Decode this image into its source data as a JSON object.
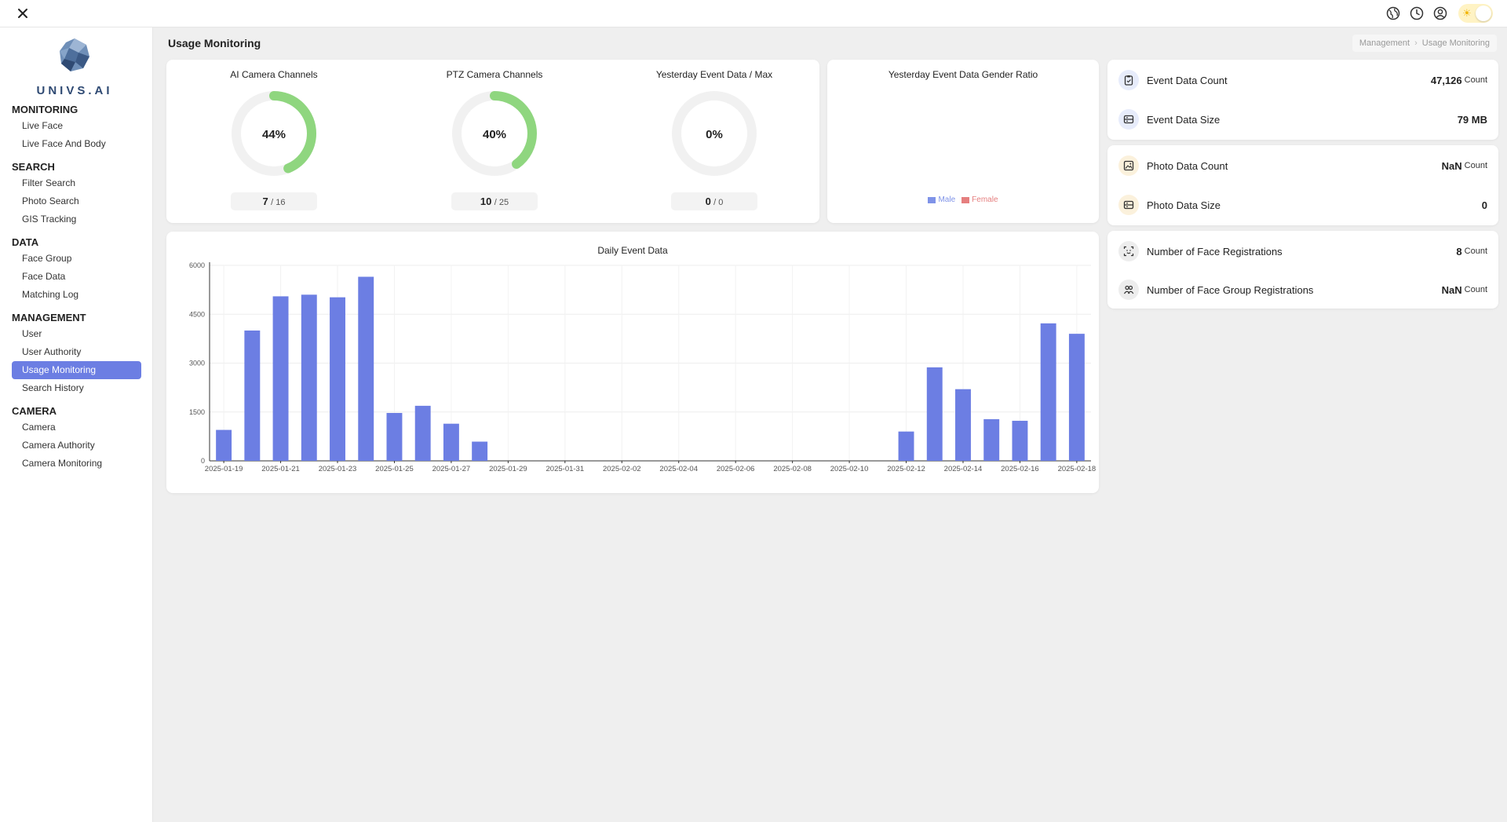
{
  "topbar": {
    "icons": [
      "globe-icon",
      "clock-icon",
      "user-icon",
      "sun-icon"
    ]
  },
  "logo": {
    "text": "UNIVS.AI"
  },
  "sidebar": {
    "sections": [
      {
        "title": "MONITORING",
        "items": [
          {
            "label": "Live Face"
          },
          {
            "label": "Live Face And Body"
          }
        ]
      },
      {
        "title": "SEARCH",
        "items": [
          {
            "label": "Filter Search"
          },
          {
            "label": "Photo Search"
          },
          {
            "label": "GIS Tracking"
          }
        ]
      },
      {
        "title": "DATA",
        "items": [
          {
            "label": "Face Group"
          },
          {
            "label": "Face Data"
          },
          {
            "label": "Matching Log"
          }
        ]
      },
      {
        "title": "MANAGEMENT",
        "items": [
          {
            "label": "User"
          },
          {
            "label": "User Authority"
          },
          {
            "label": "Usage Monitoring",
            "active": true
          },
          {
            "label": "Search History"
          }
        ]
      },
      {
        "title": "CAMERA",
        "items": [
          {
            "label": "Camera"
          },
          {
            "label": "Camera Authority"
          },
          {
            "label": "Camera Monitoring"
          }
        ]
      }
    ]
  },
  "page": {
    "title": "Usage Monitoring",
    "breadcrumb": [
      "Management",
      "Usage Monitoring"
    ]
  },
  "gauges": [
    {
      "title": "AI Camera Channels",
      "percent_label": "44%",
      "fraction": 0.4375,
      "num": "7",
      "den": "/ 16"
    },
    {
      "title": "PTZ Camera Channels",
      "percent_label": "40%",
      "fraction": 0.4,
      "num": "10",
      "den": "/ 25"
    },
    {
      "title": "Yesterday Event Data / Max",
      "percent_label": "0%",
      "fraction": 0.0,
      "num": "0",
      "den": "/ 0"
    }
  ],
  "colors": {
    "accent": "#6c7ee3",
    "gauge_fill": "#8fd67f",
    "gauge_track": "#f1f1f1",
    "male": "#7f93e8",
    "female": "#e57f7f"
  },
  "gender": {
    "title": "Yesterday Event Data Gender Ratio",
    "legend": [
      {
        "label": "Male"
      },
      {
        "label": "Female"
      }
    ]
  },
  "stats": {
    "group1": [
      {
        "label": "Event Data Count",
        "value": "47,126",
        "unit": "Count",
        "icon": "clipboard-icon"
      },
      {
        "label": "Event Data Size",
        "value": "79 MB",
        "unit": "",
        "icon": "storage-icon"
      }
    ],
    "group2": [
      {
        "label": "Photo Data Count",
        "value": "NaN",
        "unit": "Count",
        "icon": "image-icon"
      },
      {
        "label": "Photo Data Size",
        "value": "0",
        "unit": "",
        "icon": "storage-icon"
      }
    ],
    "group3": [
      {
        "label": "Number of Face Registrations",
        "value": "8",
        "unit": "Count",
        "icon": "face-scan-icon"
      },
      {
        "label": "Number of Face Group Registrations",
        "value": "NaN",
        "unit": "Count",
        "icon": "group-icon"
      }
    ]
  },
  "chart_data": {
    "type": "bar",
    "title": "Daily Event Data",
    "xlabel": "",
    "ylabel": "",
    "ylim": [
      0,
      6000
    ],
    "yticks": [
      0,
      1500,
      3000,
      4500,
      6000
    ],
    "grid": true,
    "categories": [
      "2025-01-19",
      "2025-01-20",
      "2025-01-21",
      "2025-01-22",
      "2025-01-23",
      "2025-01-24",
      "2025-01-25",
      "2025-01-26",
      "2025-01-27",
      "2025-01-28",
      "2025-01-29",
      "2025-01-30",
      "2025-01-31",
      "2025-02-01",
      "2025-02-02",
      "2025-02-03",
      "2025-02-04",
      "2025-02-05",
      "2025-02-06",
      "2025-02-07",
      "2025-02-08",
      "2025-02-09",
      "2025-02-10",
      "2025-02-11",
      "2025-02-12",
      "2025-02-13",
      "2025-02-14",
      "2025-02-15",
      "2025-02-16",
      "2025-02-17",
      "2025-02-18"
    ],
    "tick_labels": [
      "2025-01-19",
      "2025-01-21",
      "2025-01-23",
      "2025-01-25",
      "2025-01-27",
      "2025-01-29",
      "2025-01-31",
      "2025-02-02",
      "2025-02-04",
      "2025-02-06",
      "2025-02-08",
      "2025-02-10",
      "2025-02-12",
      "2025-02-14",
      "2025-02-16",
      "2025-02-18"
    ],
    "values": [
      950,
      4000,
      5050,
      5100,
      5020,
      5650,
      1470,
      1690,
      1140,
      590,
      0,
      0,
      0,
      0,
      0,
      0,
      0,
      0,
      0,
      0,
      0,
      0,
      0,
      0,
      900,
      2870,
      2200,
      1280,
      1230,
      4220,
      3900
    ]
  }
}
